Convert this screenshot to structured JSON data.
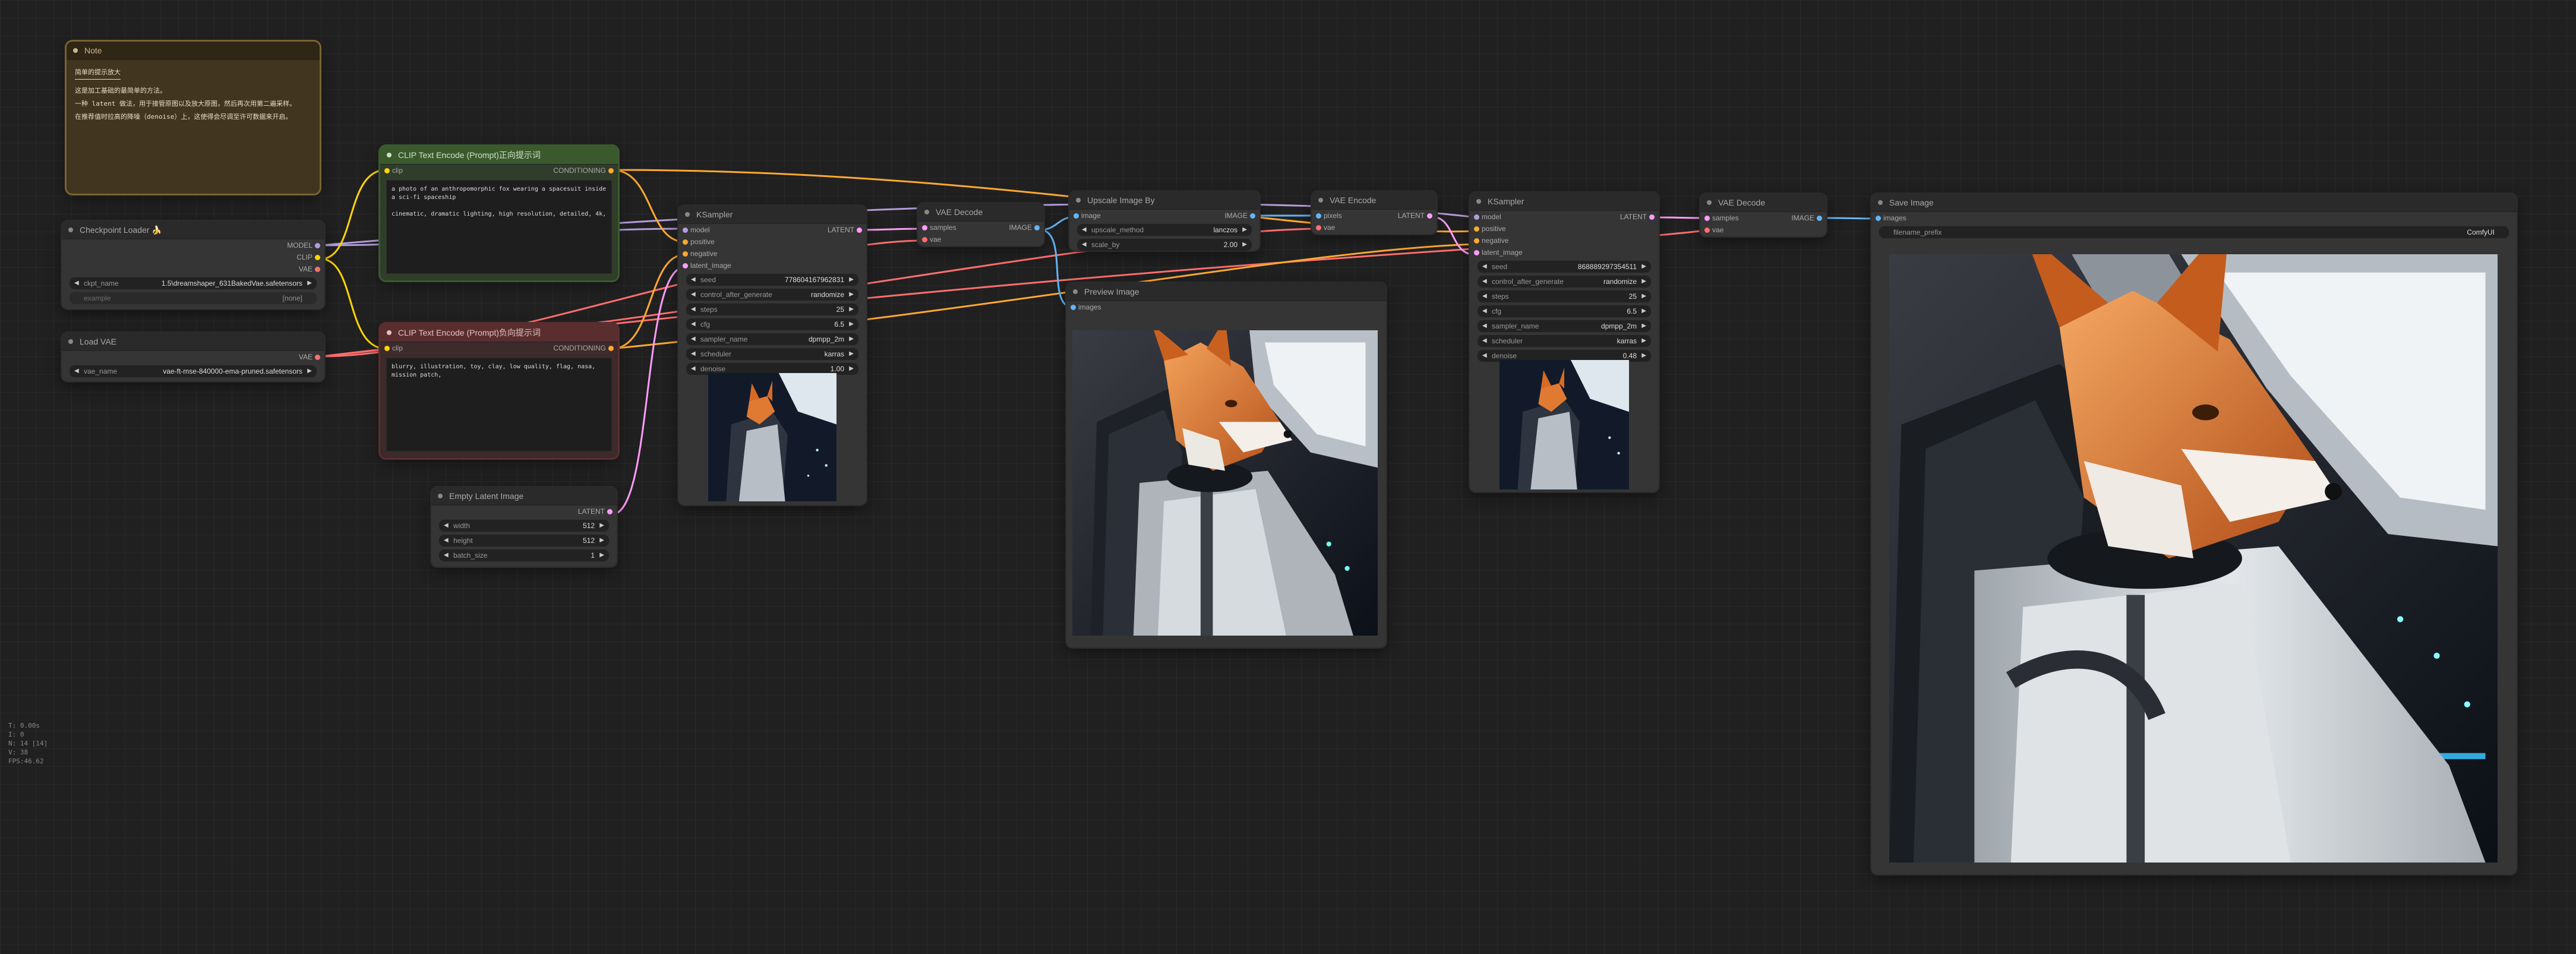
{
  "app": {
    "stats": [
      "T: 0.00s",
      "I: 0",
      "N: 14 [14]",
      "V: 38",
      "FPS:46.62"
    ]
  },
  "nodes": {
    "note": {
      "title": "Note",
      "heading": "简单的提示放大",
      "lines": [
        "这是加工基础的最简单的方法。",
        "一种 latent 做法，用于接管原图以及放大原图，然后再次用第二遍采样。",
        "在推荐值时拉高的降噪（denoise）上，这使得会尽调至许可数据来开启。"
      ]
    },
    "checkpoint_loader": {
      "title": "Checkpoint Loader 🍌",
      "outputs": [
        "MODEL",
        "CLIP",
        "VAE"
      ],
      "widgets": [
        {
          "label": "ckpt_name",
          "value": "1.5\\dreamshaper_631BakedVae.safetensors"
        },
        {
          "label": "example",
          "value": "[none]"
        }
      ]
    },
    "load_vae": {
      "title": "Load VAE",
      "outputs": [
        "VAE"
      ],
      "widgets": [
        {
          "label": "vae_name",
          "value": "vae-ft-mse-840000-ema-pruned.safetensors"
        }
      ]
    },
    "clip_pos": {
      "title": "CLIP Text Encode (Prompt)正向提示词",
      "inputs": [
        "clip"
      ],
      "outputs": [
        "CONDITIONING"
      ],
      "text": "a photo of an anthropomorphic fox wearing a spacesuit inside a sci-fi spaceship\n\ncinematic, dramatic lighting, high resolution, detailed, 4k,"
    },
    "clip_neg": {
      "title": "CLIP Text Encode (Prompt)负向提示词",
      "inputs": [
        "clip"
      ],
      "outputs": [
        "CONDITIONING"
      ],
      "text": "blurry, illustration, toy, clay, low quality, flag, nasa, mission patch,"
    },
    "empty_latent": {
      "title": "Empty Latent Image",
      "outputs": [
        "LATENT"
      ],
      "widgets": [
        {
          "label": "width",
          "value": "512"
        },
        {
          "label": "height",
          "value": "512"
        },
        {
          "label": "batch_size",
          "value": "1"
        }
      ]
    },
    "ksampler1": {
      "title": "KSampler",
      "inputs": [
        "model",
        "positive",
        "negative",
        "latent_image"
      ],
      "outputs": [
        "LATENT"
      ],
      "widgets": [
        {
          "label": "seed",
          "value": "778604167962831"
        },
        {
          "label": "control_after_generate",
          "value": "randomize"
        },
        {
          "label": "steps",
          "value": "25"
        },
        {
          "label": "cfg",
          "value": "6.5"
        },
        {
          "label": "sampler_name",
          "value": "dpmpp_2m"
        },
        {
          "label": "scheduler",
          "value": "karras"
        },
        {
          "label": "denoise",
          "value": "1.00"
        }
      ]
    },
    "vae_decode1": {
      "title": "VAE Decode",
      "inputs": [
        "samples",
        "vae"
      ],
      "outputs": [
        "IMAGE"
      ]
    },
    "upscale": {
      "title": "Upscale Image By",
      "inputs": [
        "image"
      ],
      "outputs": [
        "IMAGE"
      ],
      "widgets": [
        {
          "label": "upscale_method",
          "value": "lanczos"
        },
        {
          "label": "scale_by",
          "value": "2.00"
        }
      ]
    },
    "preview": {
      "title": "Preview Image",
      "inputs": [
        "images"
      ]
    },
    "vae_encode": {
      "title": "VAE Encode",
      "inputs": [
        "pixels",
        "vae"
      ],
      "outputs": [
        "LATENT"
      ]
    },
    "ksampler2": {
      "title": "KSampler",
      "inputs": [
        "model",
        "positive",
        "negative",
        "latent_image"
      ],
      "outputs": [
        "LATENT"
      ],
      "widgets": [
        {
          "label": "seed",
          "value": "868889297354511"
        },
        {
          "label": "control_after_generate",
          "value": "randomize"
        },
        {
          "label": "steps",
          "value": "25"
        },
        {
          "label": "cfg",
          "value": "6.5"
        },
        {
          "label": "sampler_name",
          "value": "dpmpp_2m"
        },
        {
          "label": "scheduler",
          "value": "karras"
        },
        {
          "label": "denoise",
          "value": "0.48"
        }
      ]
    },
    "vae_decode2": {
      "title": "VAE Decode",
      "inputs": [
        "samples",
        "vae"
      ],
      "outputs": [
        "IMAGE"
      ]
    },
    "save_image": {
      "title": "Save Image",
      "inputs": [
        "images"
      ],
      "widgets": [
        {
          "label": "filename_prefix",
          "value": "ComfyUI"
        }
      ]
    }
  },
  "colors": {
    "model": "#b39ddb",
    "clip": "#ffd500",
    "vae": "#ff6e6e",
    "conditioning": "#ffa931",
    "latent": "#ff9cf9",
    "image": "#64b5f6",
    "note_border": "#7a6330",
    "pos_title": "#3a5a2e",
    "neg_title": "#5a2e2e"
  }
}
